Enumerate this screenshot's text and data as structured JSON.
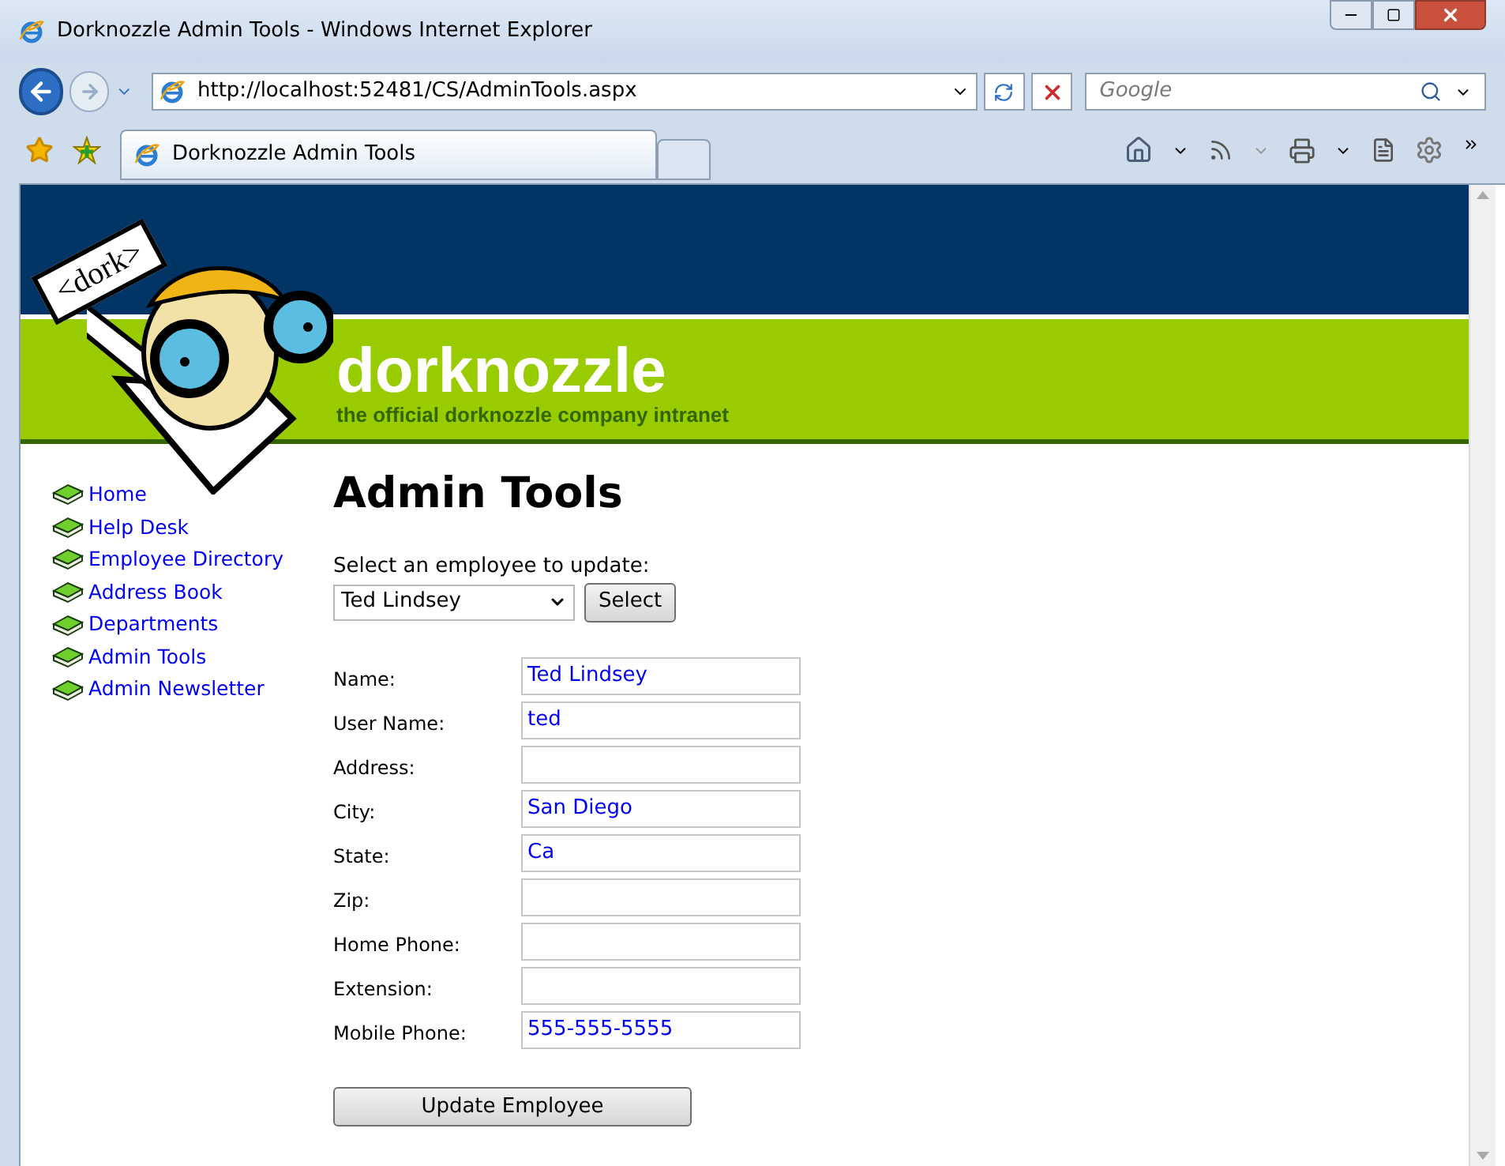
{
  "window": {
    "title": "Dorknozzle Admin Tools - Windows Internet Explorer"
  },
  "address_bar": {
    "url": "http://localhost:52481/CS/AdminTools.aspx"
  },
  "search": {
    "placeholder": "Google"
  },
  "tabs": [
    {
      "label": "Dorknozzle Admin Tools",
      "selected": true
    }
  ],
  "header": {
    "logo_sign": "<dork>",
    "site_name": "dorknozzle",
    "tagline": "the official dorknozzle company intranet"
  },
  "nav": [
    {
      "label": "Home"
    },
    {
      "label": "Help Desk"
    },
    {
      "label": "Employee Directory"
    },
    {
      "label": "Address Book"
    },
    {
      "label": "Departments"
    },
    {
      "label": "Admin Tools"
    },
    {
      "label": "Admin Newsletter"
    }
  ],
  "page": {
    "heading": "Admin Tools",
    "select_label": "Select an employee to update:",
    "employee_select": "Ted Lindsey",
    "select_button": "Select",
    "fields": [
      {
        "label": "Name:",
        "value": "Ted Lindsey"
      },
      {
        "label": "User Name:",
        "value": "ted"
      },
      {
        "label": "Address:"
      },
      {
        "label": "City:",
        "value": "San Diego"
      },
      {
        "label": "State:",
        "value": "Ca"
      },
      {
        "label": "Zip:"
      },
      {
        "label": "Home Phone:"
      },
      {
        "label": "Extension:"
      },
      {
        "label": "Mobile Phone:",
        "value": "555-555-5555"
      }
    ],
    "submit": "Update Employee"
  }
}
